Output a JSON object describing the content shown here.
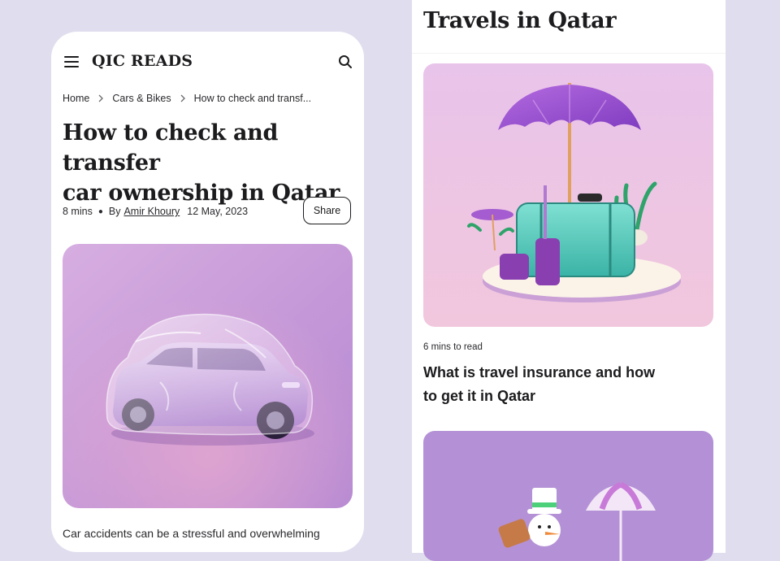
{
  "left_screen": {
    "logo": "QIC READS",
    "breadcrumb": {
      "items": [
        "Home",
        "Cars & Bikes",
        "How to check and transf..."
      ]
    },
    "article": {
      "title_line1": "How to check and transfer",
      "title_line2": "car ownership in Qatar",
      "read_time": "8 mins",
      "by_label": "By",
      "author": "Amir Khoury",
      "date": "12 May, 2023",
      "share_label": "Share",
      "body_start": "Car accidents can be a stressful and overwhelming"
    },
    "icons": {
      "menu": "menu-icon",
      "search": "search-icon",
      "breadcrumb_separator": "chevron-right-icon"
    }
  },
  "right_screen": {
    "section_title": "Travels in Qatar",
    "cards": [
      {
        "read_time": "6 mins to read",
        "title_line1": "What is travel insurance and how",
        "title_line2": "to get it in Qatar"
      }
    ]
  },
  "colors": {
    "background": "#e0deee",
    "text": "#1c1c1f",
    "card_pink": "#eec4e6",
    "card_purple": "#b491d6"
  }
}
